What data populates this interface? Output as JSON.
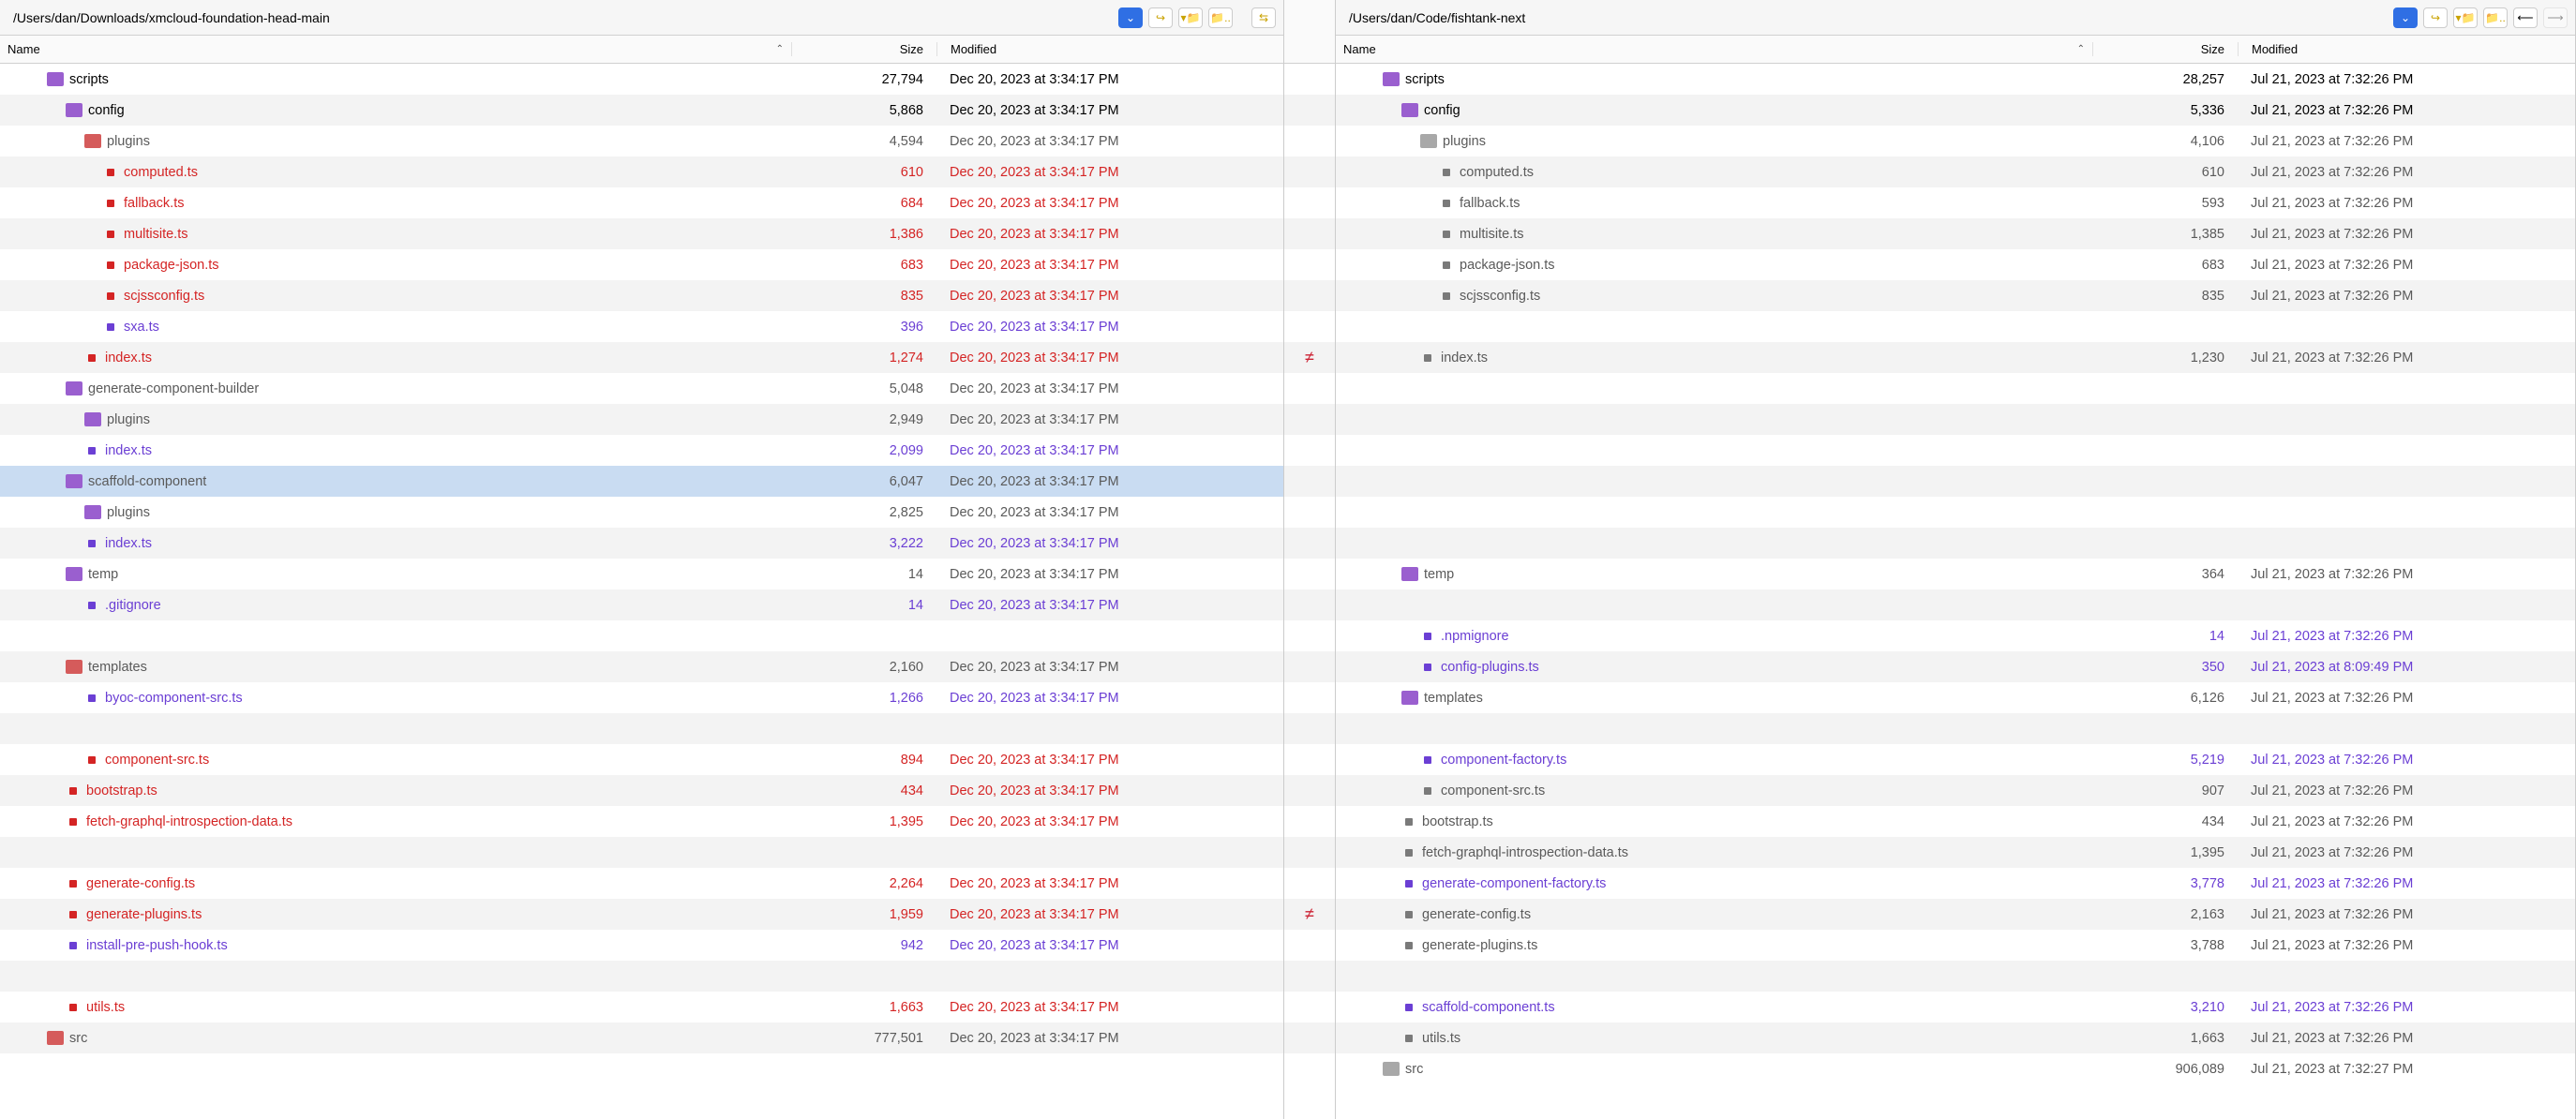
{
  "left": {
    "path": "/Users/dan/Downloads/xmcloud-foundation-head-main",
    "columns": {
      "name": "Name",
      "size": "Size",
      "modified": "Modified"
    },
    "rows": [
      {
        "indent": 2,
        "icon": "folder-purple",
        "name": "scripts",
        "size": "27,794",
        "mod": "Dec 20, 2023 at 3:34:17 PM",
        "color": "black"
      },
      {
        "indent": 3,
        "icon": "folder-purple",
        "name": "config",
        "size": "5,868",
        "mod": "Dec 20, 2023 at 3:34:17 PM",
        "color": "black"
      },
      {
        "indent": 4,
        "icon": "folder-red",
        "name": "plugins",
        "size": "4,594",
        "mod": "Dec 20, 2023 at 3:34:17 PM",
        "color": "grey"
      },
      {
        "indent": 5,
        "icon": "file-bullet",
        "bullet": "red",
        "name": "computed.ts",
        "size": "610",
        "mod": "Dec 20, 2023 at 3:34:17 PM",
        "color": "red"
      },
      {
        "indent": 5,
        "icon": "file-bullet",
        "bullet": "red",
        "name": "fallback.ts",
        "size": "684",
        "mod": "Dec 20, 2023 at 3:34:17 PM",
        "color": "red"
      },
      {
        "indent": 5,
        "icon": "file-bullet",
        "bullet": "red",
        "name": "multisite.ts",
        "size": "1,386",
        "mod": "Dec 20, 2023 at 3:34:17 PM",
        "color": "red"
      },
      {
        "indent": 5,
        "icon": "file-bullet",
        "bullet": "red",
        "name": "package-json.ts",
        "size": "683",
        "mod": "Dec 20, 2023 at 3:34:17 PM",
        "color": "red"
      },
      {
        "indent": 5,
        "icon": "file-bullet",
        "bullet": "red",
        "name": "scjssconfig.ts",
        "size": "835",
        "mod": "Dec 20, 2023 at 3:34:17 PM",
        "color": "red"
      },
      {
        "indent": 5,
        "icon": "file-bullet",
        "bullet": "purple",
        "name": "sxa.ts",
        "size": "396",
        "mod": "Dec 20, 2023 at 3:34:17 PM",
        "color": "purple"
      },
      {
        "indent": 4,
        "icon": "file-bullet",
        "bullet": "red",
        "name": "index.ts",
        "size": "1,274",
        "mod": "Dec 20, 2023 at 3:34:17 PM",
        "color": "red"
      },
      {
        "indent": 3,
        "icon": "folder-purple",
        "name": "generate-component-builder",
        "size": "5,048",
        "mod": "Dec 20, 2023 at 3:34:17 PM",
        "color": "grey"
      },
      {
        "indent": 4,
        "icon": "folder-purple",
        "name": "plugins",
        "size": "2,949",
        "mod": "Dec 20, 2023 at 3:34:17 PM",
        "color": "grey"
      },
      {
        "indent": 4,
        "icon": "file-bullet",
        "bullet": "purple",
        "name": "index.ts",
        "size": "2,099",
        "mod": "Dec 20, 2023 at 3:34:17 PM",
        "color": "purple"
      },
      {
        "indent": 3,
        "icon": "folder-purple",
        "name": "scaffold-component",
        "size": "6,047",
        "mod": "Dec 20, 2023 at 3:34:17 PM",
        "color": "grey",
        "selected": true
      },
      {
        "indent": 4,
        "icon": "folder-purple",
        "name": "plugins",
        "size": "2,825",
        "mod": "Dec 20, 2023 at 3:34:17 PM",
        "color": "grey"
      },
      {
        "indent": 4,
        "icon": "file-bullet",
        "bullet": "purple",
        "name": "index.ts",
        "size": "3,222",
        "mod": "Dec 20, 2023 at 3:34:17 PM",
        "color": "purple"
      },
      {
        "indent": 3,
        "icon": "folder-purple",
        "name": "temp",
        "size": "14",
        "mod": "Dec 20, 2023 at 3:34:17 PM",
        "color": "grey"
      },
      {
        "indent": 4,
        "icon": "file-bullet",
        "bullet": "purple",
        "name": ".gitignore",
        "size": "14",
        "mod": "Dec 20, 2023 at 3:34:17 PM",
        "color": "purple"
      },
      {
        "blank": true
      },
      {
        "indent": 3,
        "icon": "folder-red",
        "name": "templates",
        "size": "2,160",
        "mod": "Dec 20, 2023 at 3:34:17 PM",
        "color": "grey"
      },
      {
        "indent": 4,
        "icon": "file-bullet",
        "bullet": "purple",
        "name": "byoc-component-src.ts",
        "size": "1,266",
        "mod": "Dec 20, 2023 at 3:34:17 PM",
        "color": "purple"
      },
      {
        "blank": true
      },
      {
        "indent": 4,
        "icon": "file-bullet",
        "bullet": "red",
        "name": "component-src.ts",
        "size": "894",
        "mod": "Dec 20, 2023 at 3:34:17 PM",
        "color": "red"
      },
      {
        "indent": 3,
        "icon": "file-bullet",
        "bullet": "red",
        "name": "bootstrap.ts",
        "size": "434",
        "mod": "Dec 20, 2023 at 3:34:17 PM",
        "color": "red"
      },
      {
        "indent": 3,
        "icon": "file-bullet",
        "bullet": "red",
        "name": "fetch-graphql-introspection-data.ts",
        "size": "1,395",
        "mod": "Dec 20, 2023 at 3:34:17 PM",
        "color": "red"
      },
      {
        "blank": true
      },
      {
        "indent": 3,
        "icon": "file-bullet",
        "bullet": "red",
        "name": "generate-config.ts",
        "size": "2,264",
        "mod": "Dec 20, 2023 at 3:34:17 PM",
        "color": "red"
      },
      {
        "indent": 3,
        "icon": "file-bullet",
        "bullet": "red",
        "name": "generate-plugins.ts",
        "size": "1,959",
        "mod": "Dec 20, 2023 at 3:34:17 PM",
        "color": "red"
      },
      {
        "indent": 3,
        "icon": "file-bullet",
        "bullet": "purple",
        "name": "install-pre-push-hook.ts",
        "size": "942",
        "mod": "Dec 20, 2023 at 3:34:17 PM",
        "color": "purple"
      },
      {
        "blank": true
      },
      {
        "indent": 3,
        "icon": "file-bullet",
        "bullet": "red",
        "name": "utils.ts",
        "size": "1,663",
        "mod": "Dec 20, 2023 at 3:34:17 PM",
        "color": "red"
      },
      {
        "indent": 2,
        "icon": "folder-red",
        "name": "src",
        "size": "777,501",
        "mod": "Dec 20, 2023 at 3:34:17 PM",
        "color": "grey"
      }
    ]
  },
  "right": {
    "path": "/Users/dan/Code/fishtank-next",
    "columns": {
      "name": "Name",
      "size": "Size",
      "modified": "Modified"
    },
    "rows": [
      {
        "indent": 2,
        "icon": "folder-purple",
        "name": "scripts",
        "size": "28,257",
        "mod": "Jul 21, 2023 at 7:32:26 PM",
        "color": "black"
      },
      {
        "indent": 3,
        "icon": "folder-purple",
        "name": "config",
        "size": "5,336",
        "mod": "Jul 21, 2023 at 7:32:26 PM",
        "color": "black"
      },
      {
        "indent": 4,
        "icon": "folder-grey",
        "name": "plugins",
        "size": "4,106",
        "mod": "Jul 21, 2023 at 7:32:26 PM",
        "color": "grey"
      },
      {
        "indent": 5,
        "icon": "file-bullet",
        "bullet": "grey",
        "name": "computed.ts",
        "size": "610",
        "mod": "Jul 21, 2023 at 7:32:26 PM",
        "color": "grey"
      },
      {
        "indent": 5,
        "icon": "file-bullet",
        "bullet": "grey",
        "name": "fallback.ts",
        "size": "593",
        "mod": "Jul 21, 2023 at 7:32:26 PM",
        "color": "grey"
      },
      {
        "indent": 5,
        "icon": "file-bullet",
        "bullet": "grey",
        "name": "multisite.ts",
        "size": "1,385",
        "mod": "Jul 21, 2023 at 7:32:26 PM",
        "color": "grey"
      },
      {
        "indent": 5,
        "icon": "file-bullet",
        "bullet": "grey",
        "name": "package-json.ts",
        "size": "683",
        "mod": "Jul 21, 2023 at 7:32:26 PM",
        "color": "grey"
      },
      {
        "indent": 5,
        "icon": "file-bullet",
        "bullet": "grey",
        "name": "scjssconfig.ts",
        "size": "835",
        "mod": "Jul 21, 2023 at 7:32:26 PM",
        "color": "grey"
      },
      {
        "blank": true
      },
      {
        "indent": 4,
        "icon": "file-bullet",
        "bullet": "grey",
        "name": "index.ts",
        "size": "1,230",
        "mod": "Jul 21, 2023 at 7:32:26 PM",
        "color": "grey"
      },
      {
        "blank": true
      },
      {
        "blank": true
      },
      {
        "blank": true
      },
      {
        "blank": true
      },
      {
        "blank": true
      },
      {
        "blank": true
      },
      {
        "indent": 3,
        "icon": "folder-purple",
        "name": "temp",
        "size": "364",
        "mod": "Jul 21, 2023 at 7:32:26 PM",
        "color": "grey"
      },
      {
        "blank": true
      },
      {
        "indent": 4,
        "icon": "file-bullet",
        "bullet": "purple",
        "name": ".npmignore",
        "size": "14",
        "mod": "Jul 21, 2023 at 7:32:26 PM",
        "color": "purple"
      },
      {
        "indent": 4,
        "icon": "file-bullet",
        "bullet": "purple",
        "name": "config-plugins.ts",
        "size": "350",
        "mod": "Jul 21, 2023 at 8:09:49 PM",
        "color": "purple"
      },
      {
        "indent": 3,
        "icon": "folder-purple",
        "name": "templates",
        "size": "6,126",
        "mod": "Jul 21, 2023 at 7:32:26 PM",
        "color": "grey"
      },
      {
        "blank": true
      },
      {
        "indent": 4,
        "icon": "file-bullet",
        "bullet": "purple",
        "name": "component-factory.ts",
        "size": "5,219",
        "mod": "Jul 21, 2023 at 7:32:26 PM",
        "color": "purple"
      },
      {
        "indent": 4,
        "icon": "file-bullet",
        "bullet": "grey",
        "name": "component-src.ts",
        "size": "907",
        "mod": "Jul 21, 2023 at 7:32:26 PM",
        "color": "grey"
      },
      {
        "indent": 3,
        "icon": "file-bullet",
        "bullet": "grey",
        "name": "bootstrap.ts",
        "size": "434",
        "mod": "Jul 21, 2023 at 7:32:26 PM",
        "color": "grey"
      },
      {
        "indent": 3,
        "icon": "file-bullet",
        "bullet": "grey",
        "name": "fetch-graphql-introspection-data.ts",
        "size": "1,395",
        "mod": "Jul 21, 2023 at 7:32:26 PM",
        "color": "grey"
      },
      {
        "indent": 3,
        "icon": "file-bullet",
        "bullet": "purple",
        "name": "generate-component-factory.ts",
        "size": "3,778",
        "mod": "Jul 21, 2023 at 7:32:26 PM",
        "color": "purple"
      },
      {
        "indent": 3,
        "icon": "file-bullet",
        "bullet": "grey",
        "name": "generate-config.ts",
        "size": "2,163",
        "mod": "Jul 21, 2023 at 7:32:26 PM",
        "color": "grey"
      },
      {
        "indent": 3,
        "icon": "file-bullet",
        "bullet": "grey",
        "name": "generate-plugins.ts",
        "size": "3,788",
        "mod": "Jul 21, 2023 at 7:32:26 PM",
        "color": "grey"
      },
      {
        "blank": true
      },
      {
        "indent": 3,
        "icon": "file-bullet",
        "bullet": "purple",
        "name": "scaffold-component.ts",
        "size": "3,210",
        "mod": "Jul 21, 2023 at 7:32:26 PM",
        "color": "purple"
      },
      {
        "indent": 3,
        "icon": "file-bullet",
        "bullet": "grey",
        "name": "utils.ts",
        "size": "1,663",
        "mod": "Jul 21, 2023 at 7:32:26 PM",
        "color": "grey"
      },
      {
        "indent": 2,
        "icon": "folder-grey",
        "name": "src",
        "size": "906,089",
        "mod": "Jul 21, 2023 at 7:32:27 PM",
        "color": "grey"
      }
    ]
  },
  "center_markers": {
    "9": "≠",
    "27": "≠"
  },
  "swap_glyph": "⇆",
  "toolbar_icons": [
    "dropdown",
    "redo",
    "folder-open",
    "folder-up"
  ],
  "right_extra_icons": [
    "back",
    "forward"
  ]
}
